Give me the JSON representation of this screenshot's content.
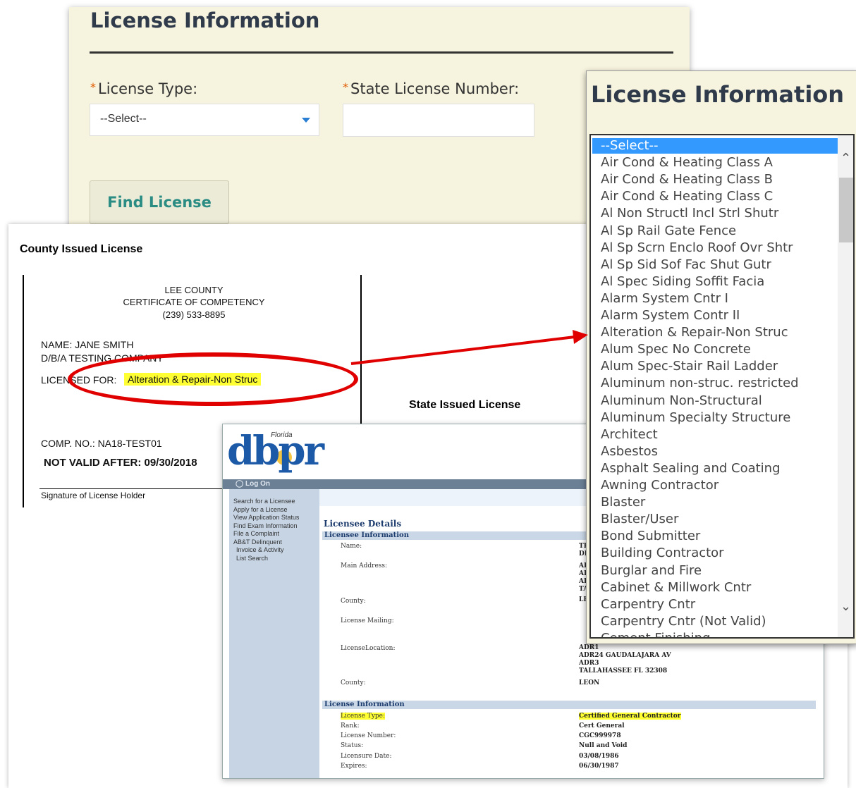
{
  "form": {
    "title": "License Information",
    "license_type_label": "License Type:",
    "state_license_label": "State License Number:",
    "select_value": "--Select--",
    "state_license_value": "",
    "find_button": "Find License"
  },
  "county": {
    "section_title": "County Issued License",
    "header_line1": "LEE COUNTY",
    "header_line2": "CERTIFICATE OF COMPETENCY",
    "header_line3": "(239) 533-8895",
    "name_line": "NAME: JANE SMITH",
    "dba_line": "D/B/A   TESTING COMPANY",
    "licensed_for_label": "LICENSED FOR:",
    "licensed_for_value": "Alteration & Repair-Non Struc",
    "comp_no": "COMP. NO.:  NA18-TEST01",
    "not_valid": "NOT VALID AFTER: 09/30/2018",
    "signature": "Signature of License Holder"
  },
  "state": {
    "section_title": "State Issued License",
    "logo_text": "dbpr",
    "logo_small": "Florida",
    "logon": "Log On",
    "nav": [
      "Search for a Licensee",
      "Apply for a License",
      "View Application Status",
      "Find Exam Information",
      "File a Complaint",
      "AB&T Delinquent",
      "Invoice & Activity",
      "List Search"
    ],
    "details_title": "Licensee Details",
    "licensee_info_header": "Licensee Information",
    "labels": {
      "name": "Name:",
      "main_address": "Main Address:",
      "county": "County:",
      "license_mailing": "License Mailing:",
      "license_location": "LicenseLocation:",
      "county2": "County:"
    },
    "values": {
      "name1": "TE",
      "name2": "DI",
      "main1": "AI",
      "main2": "AI",
      "main3": "AI",
      "main4": "TA",
      "county": "LE",
      "loc1": "ADR1",
      "loc2": "ADR24 GAUDALAJARA AV",
      "loc3": "ADR3",
      "loc4": "TALLAHASSEE  FL  32308",
      "county2": "LEON"
    },
    "license_info_header": "License Information",
    "license_rows": [
      {
        "label": "License Type:",
        "value": "Certified General Contractor"
      },
      {
        "label": "Rank:",
        "value": "Cert General"
      },
      {
        "label": "License Number:",
        "value": "CGC999978"
      },
      {
        "label": "Status:",
        "value": "Null and Void"
      },
      {
        "label": "Licensure Date:",
        "value": "03/08/1986"
      },
      {
        "label": "Expires:",
        "value": "06/30/1987"
      }
    ]
  },
  "dropdown": {
    "title": "License Information",
    "options": [
      "--Select--",
      "Air Cond & Heating Class A",
      "Air Cond & Heating Class B",
      "Air Cond & Heating Class C",
      "Al Non Structl Incl Strl Shutr",
      "Al Sp Rail Gate Fence",
      "Al Sp Scrn Enclo Roof Ovr Shtr",
      "Al Sp Sid Sof Fac Shut Gutr",
      "Al Spec Siding Soffit Facia",
      "Alarm System Cntr I",
      "Alarm System Contr II",
      "Alteration & Repair-Non Struc",
      "Alum Spec No Concrete",
      "Alum Spec-Stair Rail Ladder",
      "Aluminum non-struc. restricted",
      "Aluminum Non-Structural",
      "Aluminum Specialty Structure",
      "Architect",
      "Asbestos",
      "Asphalt Sealing and Coating",
      "Awning Contractor",
      "Blaster",
      "Blaster/User",
      "Bond Submitter",
      "Building Contractor",
      "Burglar and Fire",
      "Cabinet & Millwork Cntr",
      "Carpentry Cntr",
      "Carpentry Cntr (Not Valid)",
      "Cement Finishing"
    ]
  },
  "colors": {
    "panel_bg": "#f6f3de",
    "highlight": "#ffff33",
    "annotation_red": "#e00000",
    "selected_blue": "#3399ff",
    "find_text": "#2b8c84"
  }
}
